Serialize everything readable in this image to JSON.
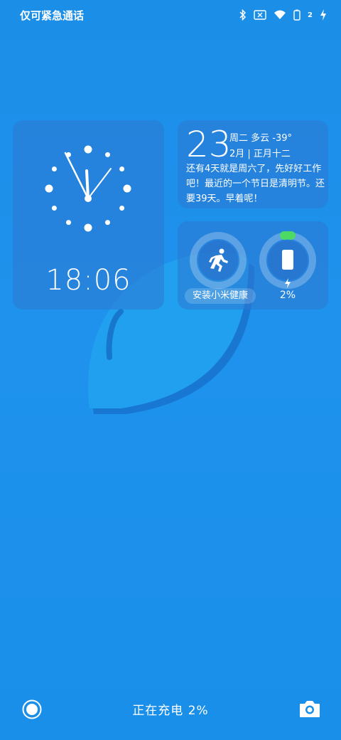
{
  "status_bar": {
    "carrier": "仅可紧急通话",
    "icons": [
      "bluetooth-icon",
      "no-sim-icon",
      "wifi-icon",
      "battery-icon",
      "charging-icon"
    ],
    "notification_count": "2"
  },
  "clock_widget": {
    "time": "18:06"
  },
  "weather_widget": {
    "day": "23",
    "weekday_weather": "周二 多云 -39°",
    "date_lunar": "2月 | 正月十二",
    "reminder": "还有4天就是周六了，先好好工作吧！最近的一个节日是清明节。还要39天。早着呢！"
  },
  "activity_widget": {
    "health_label": "安装小米健康",
    "battery_percent": "2%",
    "accent_green": "#4cd964"
  },
  "bottom_bar": {
    "charging_text": "正在充电 2%"
  }
}
